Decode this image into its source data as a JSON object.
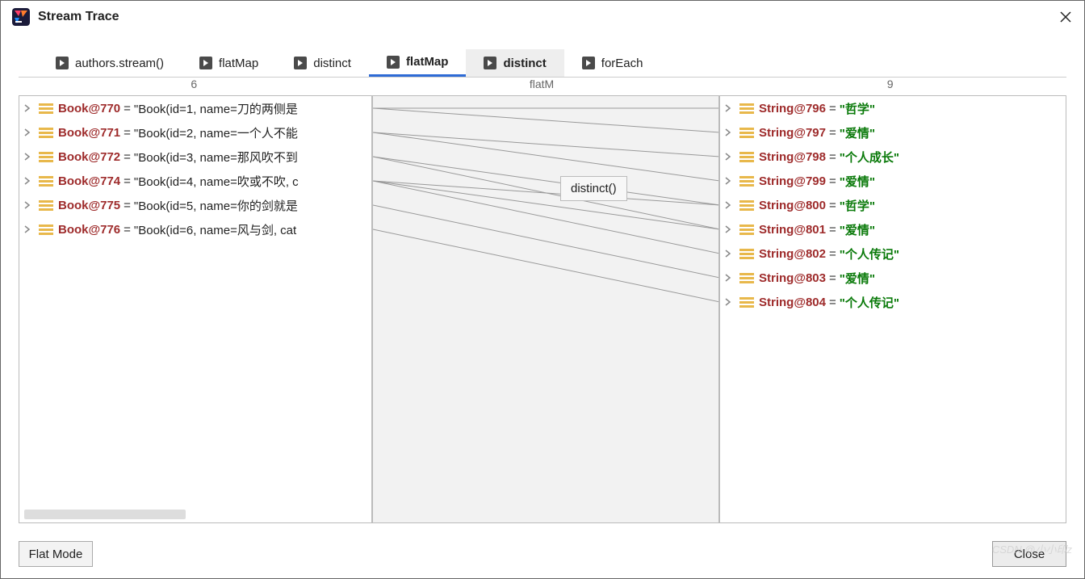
{
  "window": {
    "title": "Stream Trace"
  },
  "tabs": [
    {
      "label": "authors.stream()"
    },
    {
      "label": "flatMap"
    },
    {
      "label": "distinct"
    },
    {
      "label": "flatMap"
    },
    {
      "label": "distinct"
    },
    {
      "label": "forEach"
    }
  ],
  "active_tab_index": 3,
  "adjacent_tab_index": 4,
  "tooltip": "distinct()",
  "columns": {
    "left_count": "6",
    "mid_label": "flatM",
    "right_count": "9"
  },
  "left_rows": [
    {
      "ref": "Book@770",
      "text": "\"Book(id=1, name=刀的两侧是"
    },
    {
      "ref": "Book@771",
      "text": "\"Book(id=2, name=一个人不能"
    },
    {
      "ref": "Book@772",
      "text": "\"Book(id=3, name=那风吹不到"
    },
    {
      "ref": "Book@774",
      "text": "\"Book(id=4, name=吹或不吹, c"
    },
    {
      "ref": "Book@775",
      "text": "\"Book(id=5, name=你的剑就是"
    },
    {
      "ref": "Book@776",
      "text": "\"Book(id=6, name=风与剑, cat"
    }
  ],
  "right_rows": [
    {
      "ref": "String@796",
      "text": "\"哲学\""
    },
    {
      "ref": "String@797",
      "text": "\"爱情\""
    },
    {
      "ref": "String@798",
      "text": "\"个人成长\""
    },
    {
      "ref": "String@799",
      "text": "\"爱情\""
    },
    {
      "ref": "String@800",
      "text": "\"哲学\""
    },
    {
      "ref": "String@801",
      "text": "\"爱情\""
    },
    {
      "ref": "String@802",
      "text": "\"个人传记\""
    },
    {
      "ref": "String@803",
      "text": "\"爱情\""
    },
    {
      "ref": "String@804",
      "text": "\"个人传记\""
    }
  ],
  "connections": [
    {
      "from": 0,
      "to": 0
    },
    {
      "from": 0,
      "to": 1
    },
    {
      "from": 1,
      "to": 2
    },
    {
      "from": 1,
      "to": 3
    },
    {
      "from": 2,
      "to": 4
    },
    {
      "from": 2,
      "to": 5
    },
    {
      "from": 3,
      "to": 4
    },
    {
      "from": 3,
      "to": 5
    },
    {
      "from": 3,
      "to": 6
    },
    {
      "from": 4,
      "to": 7
    },
    {
      "from": 5,
      "to": 8
    }
  ],
  "footer": {
    "flat_mode": "Flat Mode",
    "close": "Close"
  },
  "watermark": "CSDN @小小印z"
}
